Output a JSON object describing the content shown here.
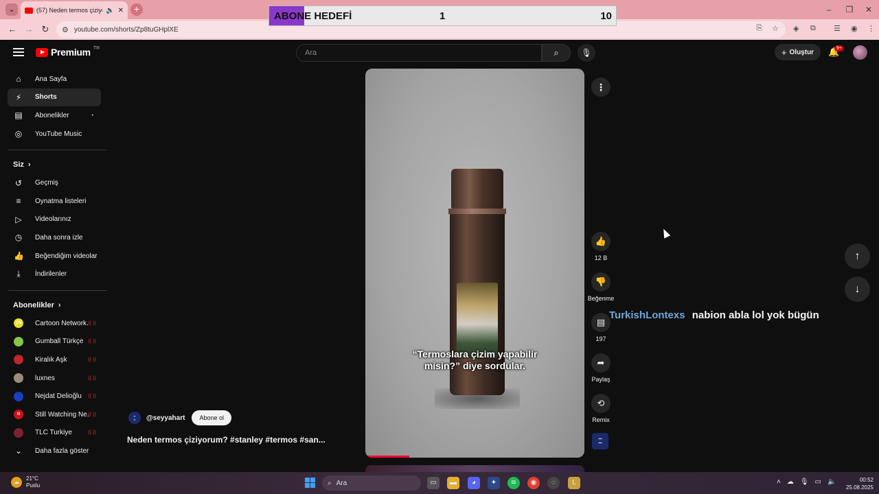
{
  "browser": {
    "tab_title": "(57) Neden termos çiziyoru",
    "url": "youtube.com/shorts/Zp8tuGHplXE"
  },
  "overlay": {
    "label": "ABONE HEDEFİ",
    "current": "1",
    "goal": "10",
    "progress_fraction": 0.1,
    "fill_color": "#8a38c9"
  },
  "header": {
    "logo_text": "Premium",
    "country_code": "TR",
    "search_placeholder": "Ara",
    "create_label": "Oluştur",
    "notification_count": "9+"
  },
  "sidebar": {
    "main": [
      {
        "label": "Ana Sayfa",
        "icon": "home-icon"
      },
      {
        "label": "Shorts",
        "icon": "shorts-icon"
      },
      {
        "label": "Abonelikler",
        "icon": "subscriptions-icon"
      },
      {
        "label": "YouTube Music",
        "icon": "music-icon"
      }
    ],
    "you_heading": "Siz",
    "you": [
      {
        "label": "Geçmiş",
        "icon": "history-icon"
      },
      {
        "label": "Oynatma listeleri",
        "icon": "playlist-icon"
      },
      {
        "label": "Videolarınız",
        "icon": "your-videos-icon"
      },
      {
        "label": "Daha sonra izle",
        "icon": "watch-later-icon"
      },
      {
        "label": "Beğendiğim videolar",
        "icon": "liked-icon"
      },
      {
        "label": "İndirilenler",
        "icon": "download-icon"
      }
    ],
    "subs_heading": "Abonelikler",
    "subscriptions": [
      {
        "label": "Cartoon Network...",
        "color": "#e8e020",
        "mark": "CN"
      },
      {
        "label": "Gumball Türkçe",
        "color": "#8ac34a",
        "mark": ""
      },
      {
        "label": "Kiralık Aşk",
        "color": "#c0242c",
        "mark": ""
      },
      {
        "label": "luxnes",
        "color": "#9a8e7a",
        "mark": ""
      },
      {
        "label": "Nejdat Delioğlu",
        "color": "#1a3ec0",
        "mark": ""
      },
      {
        "label": "Still Watching Ne...",
        "color": "#d0101a",
        "mark": "N"
      },
      {
        "label": "TLC Turkiye",
        "color": "#7a2430",
        "mark": ""
      }
    ],
    "show_more": "Daha fazla göster"
  },
  "video": {
    "caption_line1": "“Termoslara çizim yapabilir",
    "caption_line2": "misin?” diye sordular.",
    "progress_fraction": 0.2,
    "channel_handle": "@seyyahart",
    "subscribe_label": "Abone ol",
    "title": "Neden termos çiziyorum? #stanley #termos #san..."
  },
  "actions": {
    "likes": "12 B",
    "dislike_label": "Beğenme",
    "comments": "197",
    "share_label": "Paylaş",
    "remix_label": "Remix"
  },
  "chat": {
    "user": "TurkishLontexs",
    "message": "nabion abla lol yok bügün"
  },
  "taskbar": {
    "temperature": "21°C",
    "weather_text": "Puslu",
    "search_label": "Ara",
    "time": "00:52",
    "date": "25.08.2025"
  }
}
